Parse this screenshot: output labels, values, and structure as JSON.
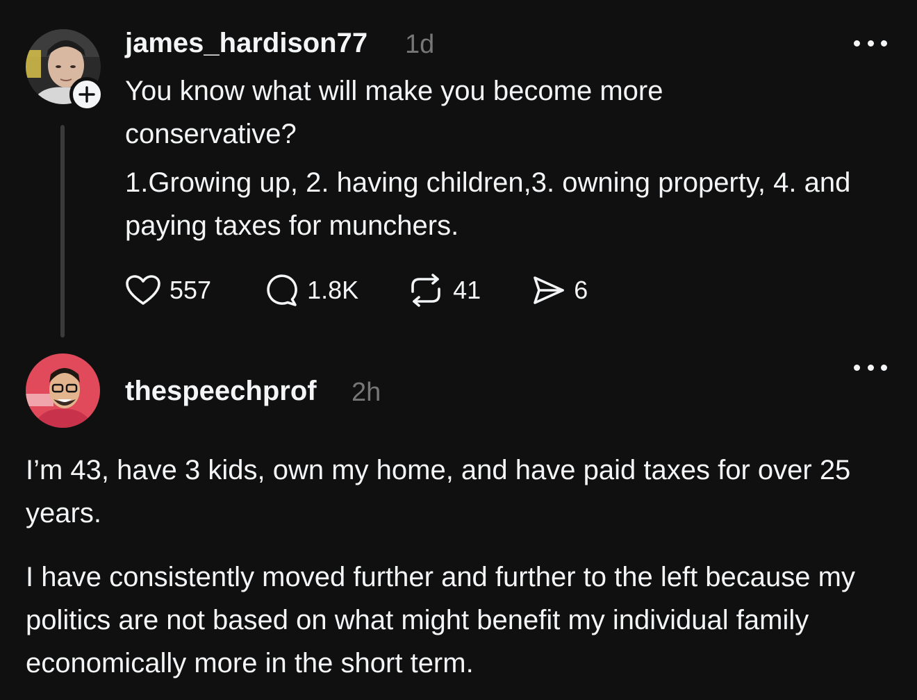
{
  "post": {
    "username": "james_hardison77",
    "time": "1d",
    "paragraphs": [
      "You know what will make you become more conservative?",
      "1.Growing up, 2. having children,3. owning property, 4. and paying taxes for munchers."
    ],
    "actions": {
      "likes": "557",
      "replies": "1.8K",
      "reposts": "41",
      "shares": "6"
    }
  },
  "reply": {
    "username": "thespeechprof",
    "time": "2h",
    "paragraphs": [
      "I’m 43, have 3 kids, own my home, and have paid taxes for over 25 years.",
      "I have consistently moved further and further to the left because my politics are not based on what might benefit my individual family economically more in the short term."
    ]
  },
  "icons": {
    "like": "heart-icon",
    "reply": "comment-bubble-icon",
    "repost": "repost-arrows-icon",
    "share": "send-paper-plane-icon",
    "more": "ellipsis-icon",
    "follow": "plus-icon"
  },
  "colors": {
    "background": "#101010",
    "text": "#f3f5f7",
    "secondary": "#777777",
    "thread_line": "#3a3a3a"
  }
}
